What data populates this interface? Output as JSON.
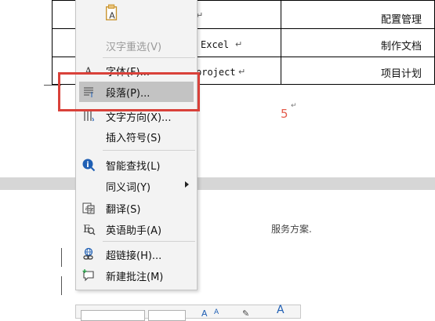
{
  "document": {
    "table_rows": [
      {
        "col2": "",
        "col3": "配置管理"
      },
      {
        "col2": "Excel",
        "col3": "制作文档"
      },
      {
        "col2": "project",
        "col3": "项目计划"
      }
    ],
    "paragraph_mark": "↵",
    "page_number": "5",
    "service_text": "服务方案."
  },
  "context_menu": {
    "items": [
      {
        "key": "paste_option",
        "label": "",
        "icon": "paste-keep-text-icon",
        "disabled": false
      },
      {
        "key": "reconvert",
        "label": "汉字重选(V)",
        "icon": "",
        "disabled": true
      },
      {
        "key": "font",
        "label": "字体(F)...",
        "icon": "font-icon",
        "disabled": false
      },
      {
        "key": "paragraph",
        "label": "段落(P)...",
        "icon": "paragraph-icon",
        "disabled": false,
        "highlighted": true
      },
      {
        "key": "text_direction",
        "label": "文字方向(X)...",
        "icon": "text-direction-icon",
        "disabled": false
      },
      {
        "key": "insert_symbol",
        "label": "插入符号(S)",
        "icon": "",
        "disabled": false
      },
      {
        "key": "smart_lookup",
        "label": "智能查找(L)",
        "icon": "smart-lookup-icon",
        "disabled": false
      },
      {
        "key": "synonyms",
        "label": "同义词(Y)",
        "icon": "",
        "disabled": false,
        "submenu": true
      },
      {
        "key": "translate",
        "label": "翻译(S)",
        "icon": "translate-icon",
        "disabled": false
      },
      {
        "key": "english_assistant",
        "label": "英语助手(A)",
        "icon": "english-assistant-icon",
        "disabled": false
      },
      {
        "key": "hyperlink",
        "label": "超链接(H)...",
        "icon": "hyperlink-icon",
        "disabled": false
      },
      {
        "key": "new_comment",
        "label": "新建批注(M)",
        "icon": "new-comment-icon",
        "disabled": false
      }
    ]
  },
  "colors": {
    "highlight_box": "#d9413a",
    "page_number": "#e45b4b",
    "icon_blue": "#1f5fb4",
    "menu_highlight": "#c3c3c3"
  }
}
